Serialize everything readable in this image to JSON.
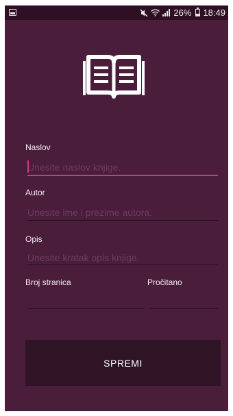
{
  "status_bar": {
    "battery": "26%",
    "time": "18:49"
  },
  "form": {
    "title": {
      "label": "Naslov",
      "placeholder": "Unesite naslov knjige.",
      "value": ""
    },
    "author": {
      "label": "Autor",
      "placeholder": "Unesite ime i prezime autora.",
      "value": ""
    },
    "description": {
      "label": "Opis",
      "placeholder": "Unesite kratak opis knjige.",
      "value": ""
    },
    "pages": {
      "label": "Broj stranica",
      "value": ""
    },
    "read": {
      "label": "Pročitano",
      "value": ""
    },
    "save_label": "SPREMI"
  },
  "icons": {
    "header": "open-book-icon",
    "status": [
      "screenshot-icon",
      "mute-icon",
      "wifi-icon",
      "signal-icon",
      "battery-icon"
    ]
  },
  "colors": {
    "background": "#4a1d3a",
    "status_bar": "#2f0f24",
    "accent": "#cc3b7a",
    "button": "#2f1425",
    "placeholder": "#6e3c5e"
  }
}
